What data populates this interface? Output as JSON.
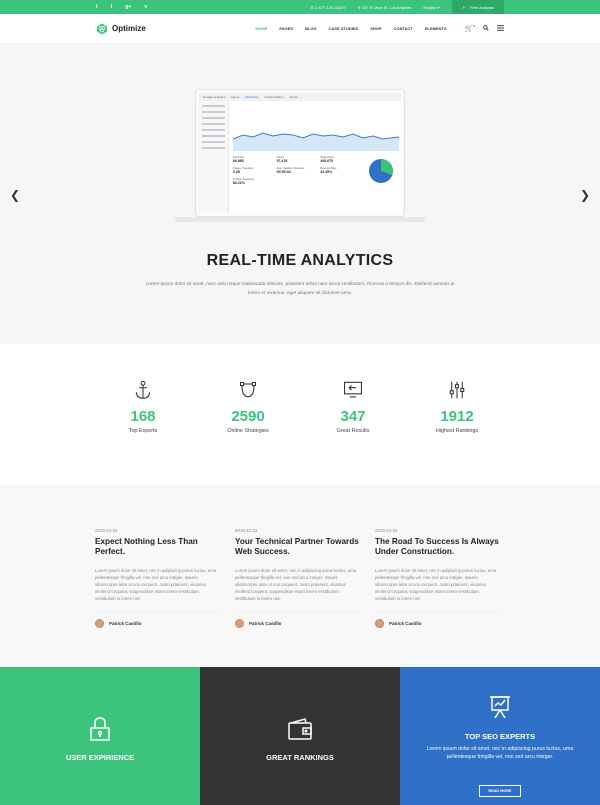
{
  "topbar": {
    "social": [
      "t",
      "f",
      "g+",
      "v"
    ],
    "phone": "1-677-124-44227",
    "address": "427 S Olive St, Los Angeles",
    "language": "English",
    "cta": "Free Analysis"
  },
  "nav": {
    "brand": "Optimize",
    "items": [
      "HOME",
      "PAGES",
      "BLOG",
      "CASE STUDIES",
      "SHOP",
      "CONTACT",
      "ELEMENTS"
    ],
    "active": "HOME",
    "cart_count": "0"
  },
  "hero": {
    "title": "REAL-TIME ANALYTICS",
    "text": "Lorem ipsum dolor sit amet, nunc wisi neque malesuada ultricies, praesent tellus nam lacus vestibulum, rhoncus a tempor dis. Eleifend aenean at lorem et vivamus, eget aliquam sit dictumst urna.",
    "screen": {
      "app": "Google Analytics",
      "tabs": [
        "Home",
        "Reporting",
        "Customization",
        "Admin"
      ],
      "metrics": [
        {
          "label": "Sessions",
          "value": "66,885"
        },
        {
          "label": "Users",
          "value": "57,476"
        },
        {
          "label": "Pageviews",
          "value": "406,675"
        },
        {
          "label": "Pages / Session",
          "value": "5.08"
        },
        {
          "label": "Avg. Session Duration",
          "value": "00:05:34"
        },
        {
          "label": "Bounce Rate",
          "value": "42.39%"
        },
        {
          "label": "% New Sessions",
          "value": "80.21%"
        }
      ]
    }
  },
  "stats": [
    {
      "icon": "anchor-icon",
      "value": "168",
      "label": "Top Experts"
    },
    {
      "icon": "bezier-pen-icon",
      "value": "2590",
      "label": "Online Strategies"
    },
    {
      "icon": "return-screen-icon",
      "value": "347",
      "label": "Great Results"
    },
    {
      "icon": "sliders-icon",
      "value": "1912",
      "label": "Highest Rankings"
    }
  ],
  "posts": [
    {
      "date": "2015-12-22",
      "title": "Expect Nothing Less Than Perfect.",
      "body": "Lorem ipsum dolor sit amet, nec in adipiscing purus luctus, urna pellentesque fringilla vel, non sed arcu integer, mauris ullamcorper ante ut non torquent. Justo praesent, vivamus eleifend torquent, suspendisse etiam lorem vestibulum, vestibulum in lorem nec.",
      "author": "Patrick Castillo"
    },
    {
      "date": "2015-12-22",
      "title": "Your Technical Partner Towards Web Success.",
      "body": "Lorem ipsum dolor sit amet, nec in adipiscing purus luctus, urna pellentesque fringilla vel, non sed arcu integer, mauris ullamcorper ante ut non torquent. Justo praesent, vivamus eleifend torquent, suspendisse etiam lorem vestibulum, vestibulum in lorem nec.",
      "author": "Patrick Castillo"
    },
    {
      "date": "2015-12-22",
      "title": "The Road To Success Is Always Under Construction.",
      "body": "Lorem ipsum dolor sit amet, nec in adipiscing purus luctus, urna pellentesque fringilla vel, non sed arcu integer, mauris ullamcorper ante ut non torquent. Justo praesent, vivamus eleifend torquent, suspendisse etiam lorem vestibulum, vestibulum in lorem nec.",
      "author": "Patrick Castillo"
    }
  ],
  "tiles": [
    {
      "title": "USER EXPIRIENCE",
      "color": "#3cc47c",
      "icon": "lock-icon"
    },
    {
      "title": "GREAT RANKINGS",
      "color": "#333333",
      "icon": "wallet-icon"
    },
    {
      "title": "TOP SEO EXPERTS",
      "color": "#2f70c9",
      "icon": "presentation-icon",
      "text": "Lorem ipsum dolor sit amet, nec in adipiscing purus luctus, urna pellentesque fringilla vel, non sed arcu integer.",
      "button": "READ MORE"
    }
  ]
}
